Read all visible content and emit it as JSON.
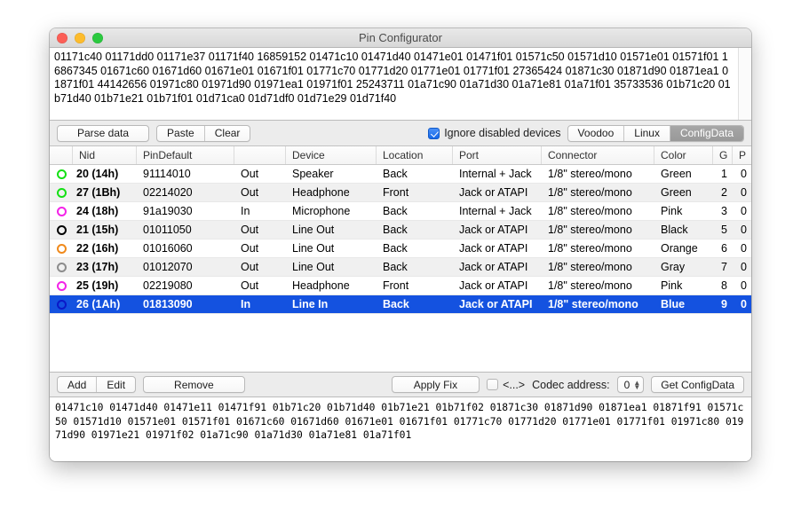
{
  "window": {
    "title": "Pin Configurator",
    "traffic_lights": [
      "close-button",
      "minimize-button",
      "zoom-button"
    ]
  },
  "top_text_area": {
    "content": "01171c40 01171dd0 01171e37 01171f40 16859152 01471c10 01471d40 01471e01 01471f01 01571c50 01571d10 01571e01 01571f01 16867345 01671c60 01671d60 01671e01 01671f01 01771c70 01771d20 01771e01 01771f01 27365424 01871c30 01871d90 01871ea1 01871f01 44142656 01971c80 01971d90 01971ea1 01971f01 25243711 01a71c90 01a71d30 01a71e81 01a71f01 35733536 01b71c20 01b71d40 01b71e21 01b71f01 01d71ca0 01d71df0 01d71e29 01d71f40"
  },
  "toolbar_top": {
    "parse_data_label": "Parse data",
    "paste_label": "Paste",
    "clear_label": "Clear",
    "ignore_disabled_label": "Ignore disabled devices",
    "ignore_disabled_checked": true,
    "segments": [
      {
        "label": "Voodoo",
        "active": false
      },
      {
        "label": "Linux",
        "active": false
      },
      {
        "label": "ConfigData",
        "active": true
      }
    ]
  },
  "table": {
    "columns": [
      {
        "key": "icon",
        "label": ""
      },
      {
        "key": "nid",
        "label": "Nid"
      },
      {
        "key": "pindefault",
        "label": "PinDefault"
      },
      {
        "key": "direction",
        "label": ""
      },
      {
        "key": "device",
        "label": "Device"
      },
      {
        "key": "location",
        "label": "Location"
      },
      {
        "key": "port",
        "label": "Port"
      },
      {
        "key": "connector",
        "label": "Connector"
      },
      {
        "key": "color",
        "label": "Color"
      },
      {
        "key": "g",
        "label": "G"
      },
      {
        "key": "p",
        "label": "P"
      }
    ],
    "rows": [
      {
        "icon_color": "#14e014",
        "nid": "20 (14h)",
        "pindefault": "91114010",
        "direction": "Out",
        "device": "Speaker",
        "location": "Back",
        "port": "Internal + Jack",
        "connector": "1/8\" stereo/mono",
        "color": "Green",
        "g": "1",
        "p": "0",
        "selected": false
      },
      {
        "icon_color": "#14e014",
        "nid": "27 (1Bh)",
        "pindefault": "02214020",
        "direction": "Out",
        "device": "Headphone",
        "location": "Front",
        "port": "Jack or ATAPI",
        "connector": "1/8\" stereo/mono",
        "color": "Green",
        "g": "2",
        "p": "0",
        "selected": false
      },
      {
        "icon_color": "#f423e8",
        "nid": "24 (18h)",
        "pindefault": "91a19030",
        "direction": "In",
        "device": "Microphone",
        "location": "Back",
        "port": "Internal + Jack",
        "connector": "1/8\" stereo/mono",
        "color": "Pink",
        "g": "3",
        "p": "0",
        "selected": false
      },
      {
        "icon_color": "#000000",
        "nid": "21 (15h)",
        "pindefault": "01011050",
        "direction": "Out",
        "device": "Line Out",
        "location": "Back",
        "port": "Jack or ATAPI",
        "connector": "1/8\" stereo/mono",
        "color": "Black",
        "g": "5",
        "p": "0",
        "selected": false
      },
      {
        "icon_color": "#f08a1c",
        "nid": "22 (16h)",
        "pindefault": "01016060",
        "direction": "Out",
        "device": "Line Out",
        "location": "Back",
        "port": "Jack or ATAPI",
        "connector": "1/8\" stereo/mono",
        "color": "Orange",
        "g": "6",
        "p": "0",
        "selected": false
      },
      {
        "icon_color": "#8c8c8c",
        "nid": "23 (17h)",
        "pindefault": "01012070",
        "direction": "Out",
        "device": "Line Out",
        "location": "Back",
        "port": "Jack or ATAPI",
        "connector": "1/8\" stereo/mono",
        "color": "Gray",
        "g": "7",
        "p": "0",
        "selected": false
      },
      {
        "icon_color": "#f423e8",
        "nid": "25 (19h)",
        "pindefault": "02219080",
        "direction": "Out",
        "device": "Headphone",
        "location": "Front",
        "port": "Jack or ATAPI",
        "connector": "1/8\" stereo/mono",
        "color": "Pink",
        "g": "8",
        "p": "0",
        "selected": false
      },
      {
        "icon_color": "#0a18c8",
        "nid": "26 (1Ah)",
        "pindefault": "01813090",
        "direction": "In",
        "device": "Line In",
        "location": "Back",
        "port": "Jack or ATAPI",
        "connector": "1/8\" stereo/mono",
        "color": "Blue",
        "g": "9",
        "p": "0",
        "selected": true
      }
    ]
  },
  "toolbar_bottom": {
    "add_label": "Add",
    "edit_label": "Edit",
    "remove_label": "Remove",
    "apply_fix_label": "Apply Fix",
    "fix_checkbox_label": "<...>",
    "fix_checkbox_checked": false,
    "codec_address_label": "Codec address:",
    "codec_address_value": "0",
    "get_configdata_label": "Get ConfigData"
  },
  "bottom_text_area": {
    "content": "01471c10 01471d40 01471e11 01471f91 01b71c20 01b71d40 01b71e21 01b71f02 01871c30 01871d90 01871ea1 01871f91 01571c50 01571d10 01571e01 01571f01 01671c60 01671d60 01671e01 01671f01 01771c70 01771d20 01771e01 01771f01 01971c80 01971d90 01971e21 01971f02 01a71c90 01a71d30 01a71e81 01a71f01"
  },
  "colors": {
    "selection_blue": "#1452e0",
    "segment_active": "#999999",
    "checkbox_blue": "#1567e8"
  }
}
